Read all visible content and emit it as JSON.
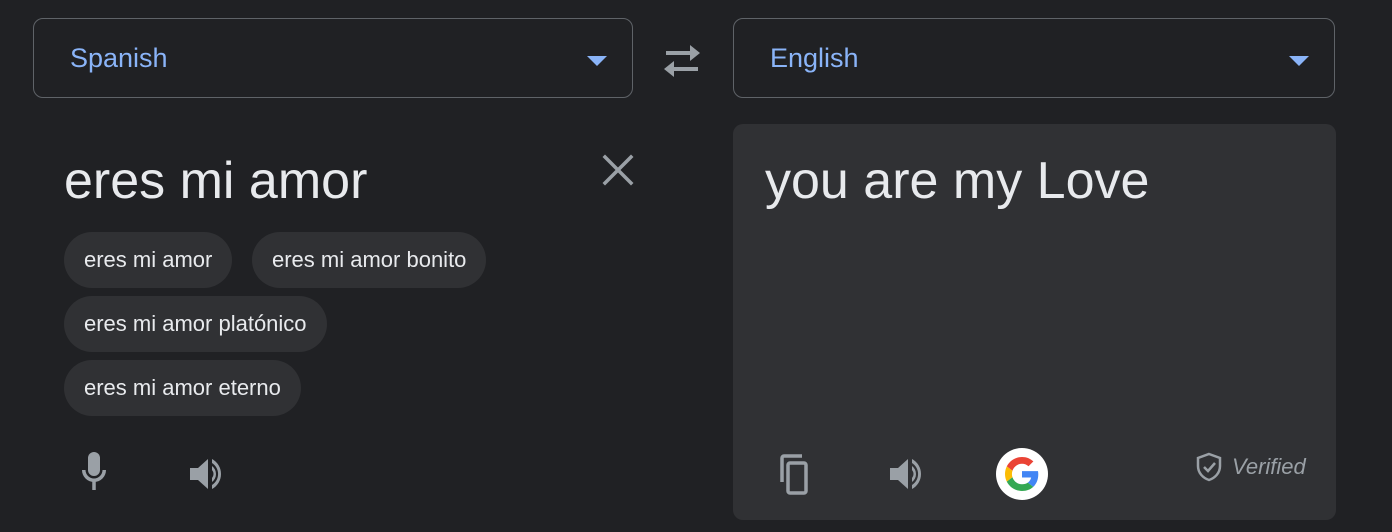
{
  "source": {
    "language": "Spanish",
    "text": "eres mi amor",
    "suggestions": [
      "eres mi amor",
      "eres mi amor bonito",
      "eres mi amor platónico",
      "eres mi amor eterno"
    ]
  },
  "target": {
    "language": "English",
    "text": "you are my Love",
    "verified_label": "Verified"
  },
  "colors": {
    "background": "#202124",
    "panel": "#303134",
    "accent": "#8ab4f8",
    "text": "#e8eaed",
    "muted": "#9aa0a6"
  },
  "icons": {
    "swap": "swap-languages-icon",
    "clear": "close-icon",
    "mic": "microphone-icon",
    "speaker": "speaker-icon",
    "copy": "copy-icon",
    "google": "google-g-icon",
    "shield": "shield-check-icon"
  }
}
